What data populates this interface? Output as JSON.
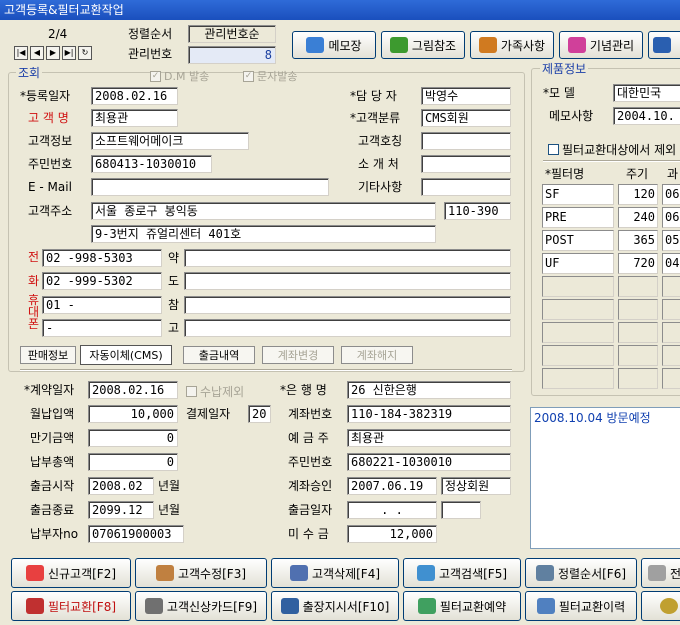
{
  "window_title": "고객등록&필터교환작업",
  "record_nav": {
    "position": "2/4",
    "buttons": [
      "|◀",
      "◀",
      "▶",
      "▶|",
      "↻"
    ]
  },
  "sort": {
    "order_label": "정렬순서",
    "order_value": "관리번호순",
    "mgmt_no_label": "관리번호",
    "mgmt_no_value": "8"
  },
  "top_buttons": [
    {
      "label": "메모장",
      "icon": "memo-icon",
      "color": "#3a7fd5"
    },
    {
      "label": "그림참조",
      "icon": "tree-icon",
      "color": "#3d9a2f"
    },
    {
      "label": "가족사항",
      "icon": "family-icon",
      "color": "#d07a20"
    },
    {
      "label": "기념관리",
      "icon": "gift-icon",
      "color": "#d0409a"
    },
    {
      "label": "",
      "icon": "chart-icon",
      "color": "#2a5fb0"
    }
  ],
  "lookup": {
    "group_label": "조회",
    "dm_label": "D.M 발송",
    "sms_label": "문자발송",
    "reg_date_label": "*등록일자",
    "reg_date": "2008.02.16",
    "manager_label": "*담 당 자",
    "manager": "박영수",
    "name_label": "고 객 명",
    "name": "최용관",
    "category_label": "*고객분류",
    "category": "CMS회원",
    "info_label": "고객정보",
    "info": "소프트웨어메이크",
    "title_label": "고객호칭",
    "title": "",
    "rrn_label": "주민번호",
    "rrn": "680413-1030010",
    "referrer_label": "소 개 처",
    "referrer": "",
    "email_label": "E - Mail",
    "email": "",
    "etc_label": "기타사항",
    "etc": "",
    "address_label": "고객주소",
    "address1": "서울 종로구 봉익동",
    "zip": "110-390",
    "address2": "9-3번지 쥬얼리센터 401호",
    "phone_side": [
      "전",
      "화"
    ],
    "mobile_side": [
      "휴",
      "대",
      "폰"
    ],
    "phone1": "02  -998-5303",
    "phone2": "02  -999-5302",
    "mobile1": "01 -",
    "mobile2": "-",
    "short_labels": [
      "약",
      "도",
      "참",
      "고"
    ]
  },
  "tabs": [
    {
      "label": "판매정보",
      "disabled": false
    },
    {
      "label": "자동이체(CMS)",
      "disabled": false
    },
    {
      "label": "출금내역",
      "disabled": false
    },
    {
      "label": "계좌변경",
      "disabled": true
    },
    {
      "label": "계좌해지",
      "disabled": true
    }
  ],
  "cms": {
    "contract_date_label": "*계약일자",
    "contract_date": "2008.02.16",
    "exclude_label": "수납제외",
    "bank_label": "*은 행 명",
    "bank": "26 신한은행",
    "monthly_label": "월납입액",
    "monthly": "10,000",
    "pay_day_label": "결제일자",
    "pay_day": "20",
    "account_label": "계좌번호",
    "account": "110-184-382319",
    "maturity_label": "만기금액",
    "maturity": "0",
    "depositor_label": "예 금 주",
    "depositor": "최용관",
    "paid_total_label": "납부총액",
    "paid_total": "0",
    "dep_rrn_label": "주민번호",
    "dep_rrn": "680221-1030010",
    "start_label": "출금시작",
    "start": "2008.02",
    "start_unit": "년월",
    "approval_label": "계좌승인",
    "approval": "2007.06.19",
    "approval_status": "정상회원",
    "end_label": "출금종료",
    "end": "2099.12",
    "end_unit": "년월",
    "wd_date_label": "출금일자",
    "wd_date": ".  .",
    "payer_no_label": "납부자no",
    "payer_no": "07061900003",
    "unpaid_label": "미 수 금",
    "unpaid": "12,000"
  },
  "product": {
    "group_label": "제품정보",
    "model_label": "*모    델",
    "model": "대한민국",
    "memo_label": "메모사항",
    "memo": "2004.10.",
    "exclude_label": "필터교환대상에서 제외",
    "headers": [
      "*필터명",
      "주기",
      "과"
    ],
    "rows": [
      {
        "name": "SF",
        "cycle": "120",
        "extra": "06"
      },
      {
        "name": "PRE",
        "cycle": "240",
        "extra": "06"
      },
      {
        "name": "POST",
        "cycle": "365",
        "extra": "05"
      },
      {
        "name": "UF",
        "cycle": "720",
        "extra": "04"
      }
    ],
    "note": "2008.10.04 방문예정"
  },
  "bottom_buttons_row1": [
    {
      "label": "신규고객[F2]",
      "icon": "new-customer-icon"
    },
    {
      "label": "고객수정[F3]",
      "icon": "edit-customer-icon"
    },
    {
      "label": "고객삭제[F4]",
      "icon": "delete-customer-icon"
    },
    {
      "label": "고객검색[F5]",
      "icon": "search-customer-icon"
    },
    {
      "label": "정렬순서[F6]",
      "icon": "sort-order-icon"
    },
    {
      "label": "전",
      "icon": "document-icon"
    }
  ],
  "bottom_buttons_row2": [
    {
      "label": "필터교환[F8]",
      "icon": "filter-icon"
    },
    {
      "label": "고객신상카드[F9]",
      "icon": "printer-icon"
    },
    {
      "label": "출장지시서[F10]",
      "icon": "printer-icon"
    },
    {
      "label": "필터교환예약",
      "icon": "calendar-icon"
    },
    {
      "label": "필터교환이력",
      "icon": "history-icon"
    },
    {
      "label": "",
      "icon": "gear-icon"
    }
  ]
}
